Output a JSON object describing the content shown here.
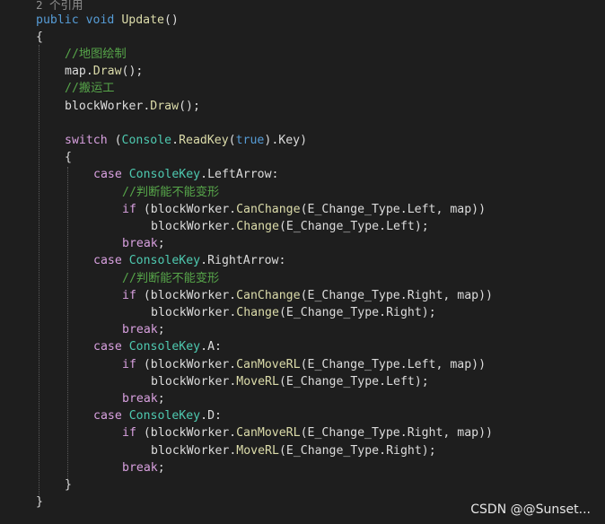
{
  "editor": {
    "codelens": "2 个引用",
    "lines": [
      [
        [
          "kw",
          "public"
        ],
        [
          "id",
          " "
        ],
        [
          "kw",
          "void"
        ],
        [
          "id",
          " "
        ],
        [
          "fn",
          "Update"
        ],
        [
          "pn",
          "()"
        ]
      ],
      [
        [
          "pn",
          "{"
        ]
      ],
      [
        [
          "cm",
          "//地图绘制"
        ]
      ],
      [
        [
          "id",
          "map"
        ],
        [
          "pn",
          "."
        ],
        [
          "fn",
          "Draw"
        ],
        [
          "pn",
          "();"
        ]
      ],
      [
        [
          "cm",
          "//搬运工"
        ]
      ],
      [
        [
          "id",
          "blockWorker"
        ],
        [
          "pn",
          "."
        ],
        [
          "fn",
          "Draw"
        ],
        [
          "pn",
          "();"
        ]
      ],
      [],
      [
        [
          "ctl",
          "switch"
        ],
        [
          "id",
          " "
        ],
        [
          "pn",
          "("
        ],
        [
          "ty",
          "Console"
        ],
        [
          "pn",
          "."
        ],
        [
          "fn",
          "ReadKey"
        ],
        [
          "pn",
          "("
        ],
        [
          "kw",
          "true"
        ],
        [
          "pn",
          ")."
        ],
        [
          "id",
          "Key"
        ],
        [
          "pn",
          ")"
        ]
      ],
      [
        [
          "pn",
          "{"
        ]
      ],
      [
        [
          "ctl",
          "case"
        ],
        [
          "id",
          " "
        ],
        [
          "ty",
          "ConsoleKey"
        ],
        [
          "pn",
          "."
        ],
        [
          "id",
          "LeftArrow"
        ],
        [
          "pn",
          ":"
        ]
      ],
      [
        [
          "cm",
          "//判断能不能变形"
        ]
      ],
      [
        [
          "ctl",
          "if"
        ],
        [
          "id",
          " "
        ],
        [
          "pn",
          "("
        ],
        [
          "id",
          "blockWorker"
        ],
        [
          "pn",
          "."
        ],
        [
          "fn",
          "CanChange"
        ],
        [
          "pn",
          "("
        ],
        [
          "id",
          "E_Change_Type"
        ],
        [
          "pn",
          "."
        ],
        [
          "id",
          "Left"
        ],
        [
          "pn",
          ", "
        ],
        [
          "id",
          "map"
        ],
        [
          "pn",
          "))"
        ]
      ],
      [
        [
          "id",
          "blockWorker"
        ],
        [
          "pn",
          "."
        ],
        [
          "fn",
          "Change"
        ],
        [
          "pn",
          "("
        ],
        [
          "id",
          "E_Change_Type"
        ],
        [
          "pn",
          "."
        ],
        [
          "id",
          "Left"
        ],
        [
          "pn",
          ");"
        ]
      ],
      [
        [
          "ctl",
          "break"
        ],
        [
          "pn",
          ";"
        ]
      ],
      [
        [
          "ctl",
          "case"
        ],
        [
          "id",
          " "
        ],
        [
          "ty",
          "ConsoleKey"
        ],
        [
          "pn",
          "."
        ],
        [
          "id",
          "RightArrow"
        ],
        [
          "pn",
          ":"
        ]
      ],
      [
        [
          "cm",
          "//判断能不能变形"
        ]
      ],
      [
        [
          "ctl",
          "if"
        ],
        [
          "id",
          " "
        ],
        [
          "pn",
          "("
        ],
        [
          "id",
          "blockWorker"
        ],
        [
          "pn",
          "."
        ],
        [
          "fn",
          "CanChange"
        ],
        [
          "pn",
          "("
        ],
        [
          "id",
          "E_Change_Type"
        ],
        [
          "pn",
          "."
        ],
        [
          "id",
          "Right"
        ],
        [
          "pn",
          ", "
        ],
        [
          "id",
          "map"
        ],
        [
          "pn",
          "))"
        ]
      ],
      [
        [
          "id",
          "blockWorker"
        ],
        [
          "pn",
          "."
        ],
        [
          "fn",
          "Change"
        ],
        [
          "pn",
          "("
        ],
        [
          "id",
          "E_Change_Type"
        ],
        [
          "pn",
          "."
        ],
        [
          "id",
          "Right"
        ],
        [
          "pn",
          ");"
        ]
      ],
      [
        [
          "ctl",
          "break"
        ],
        [
          "pn",
          ";"
        ]
      ],
      [
        [
          "ctl",
          "case"
        ],
        [
          "id",
          " "
        ],
        [
          "ty",
          "ConsoleKey"
        ],
        [
          "pn",
          "."
        ],
        [
          "id",
          "A"
        ],
        [
          "pn",
          ":"
        ]
      ],
      [
        [
          "ctl",
          "if"
        ],
        [
          "id",
          " "
        ],
        [
          "pn",
          "("
        ],
        [
          "id",
          "blockWorker"
        ],
        [
          "pn",
          "."
        ],
        [
          "fn",
          "CanMoveRL"
        ],
        [
          "pn",
          "("
        ],
        [
          "id",
          "E_Change_Type"
        ],
        [
          "pn",
          "."
        ],
        [
          "id",
          "Left"
        ],
        [
          "pn",
          ", "
        ],
        [
          "id",
          "map"
        ],
        [
          "pn",
          "))"
        ]
      ],
      [
        [
          "id",
          "blockWorker"
        ],
        [
          "pn",
          "."
        ],
        [
          "fn",
          "MoveRL"
        ],
        [
          "pn",
          "("
        ],
        [
          "id",
          "E_Change_Type"
        ],
        [
          "pn",
          "."
        ],
        [
          "id",
          "Left"
        ],
        [
          "pn",
          ");"
        ]
      ],
      [
        [
          "ctl",
          "break"
        ],
        [
          "pn",
          ";"
        ]
      ],
      [
        [
          "ctl",
          "case"
        ],
        [
          "id",
          " "
        ],
        [
          "ty",
          "ConsoleKey"
        ],
        [
          "pn",
          "."
        ],
        [
          "id",
          "D"
        ],
        [
          "pn",
          ":"
        ]
      ],
      [
        [
          "ctl",
          "if"
        ],
        [
          "id",
          " "
        ],
        [
          "pn",
          "("
        ],
        [
          "id",
          "blockWorker"
        ],
        [
          "pn",
          "."
        ],
        [
          "fn",
          "CanMoveRL"
        ],
        [
          "pn",
          "("
        ],
        [
          "id",
          "E_Change_Type"
        ],
        [
          "pn",
          "."
        ],
        [
          "id",
          "Right"
        ],
        [
          "pn",
          ", "
        ],
        [
          "id",
          "map"
        ],
        [
          "pn",
          "))"
        ]
      ],
      [
        [
          "id",
          "blockWorker"
        ],
        [
          "pn",
          "."
        ],
        [
          "fn",
          "MoveRL"
        ],
        [
          "pn",
          "("
        ],
        [
          "id",
          "E_Change_Type"
        ],
        [
          "pn",
          "."
        ],
        [
          "id",
          "Right"
        ],
        [
          "pn",
          ");"
        ]
      ],
      [
        [
          "ctl",
          "break"
        ],
        [
          "pn",
          ";"
        ]
      ],
      [
        [
          "pn",
          "}"
        ]
      ],
      [
        [
          "pn",
          "}"
        ]
      ]
    ]
  },
  "watermark": "CSDN @@Sunset..."
}
